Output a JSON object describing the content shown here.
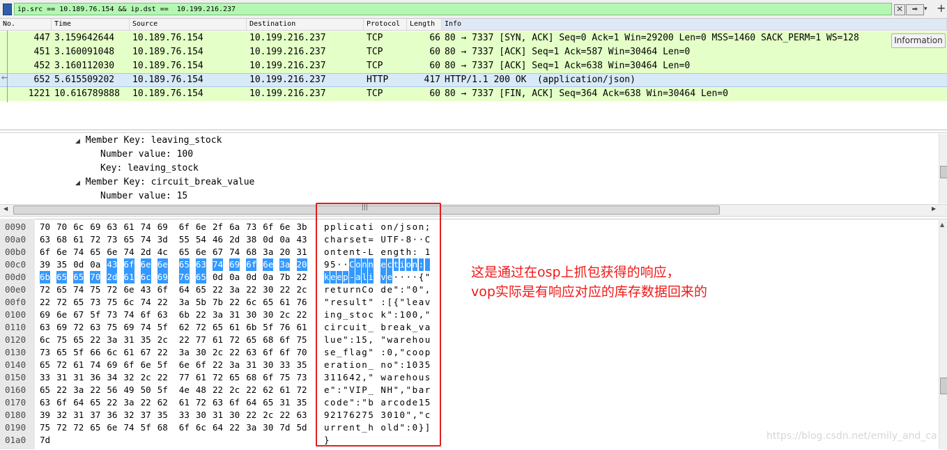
{
  "filter": {
    "text": "ip.src == 10.189.76.154 && ip.dst ==  10.199.216.237",
    "clear_icon": "close-icon",
    "apply_icon": "arrow-right-icon"
  },
  "packet_list": {
    "columns": [
      "No.",
      "Time",
      "Source",
      "Destination",
      "Protocol",
      "Length",
      "Info"
    ],
    "rows": [
      {
        "no": "447",
        "time": "3.159642644",
        "src": "10.189.76.154",
        "dst": "10.199.216.237",
        "proto": "TCP",
        "len": "66",
        "info": "80 → 7337 [SYN, ACK] Seq=0 Ack=1 Win=29200 Len=0 MSS=1460 SACK_PERM=1 WS=128"
      },
      {
        "no": "451",
        "time": "3.160091048",
        "src": "10.189.76.154",
        "dst": "10.199.216.237",
        "proto": "TCP",
        "len": "60",
        "info": "80 → 7337 [ACK] Seq=1 Ack=587 Win=30464 Len=0"
      },
      {
        "no": "452",
        "time": "3.160112030",
        "src": "10.189.76.154",
        "dst": "10.199.216.237",
        "proto": "TCP",
        "len": "60",
        "info": "80 → 7337 [ACK] Seq=1 Ack=638 Win=30464 Len=0"
      },
      {
        "no": "652",
        "time": "5.615509202",
        "src": "10.189.76.154",
        "dst": "10.199.216.237",
        "proto": "HTTP",
        "len": "417",
        "info": "HTTP/1.1 200 OK  (application/json)"
      },
      {
        "no": "1221",
        "time": "10.616789888",
        "src": "10.189.76.154",
        "dst": "10.199.216.237",
        "proto": "TCP",
        "len": "60",
        "info": "80 → 7337 [FIN, ACK] Seq=364 Ack=638 Win=30464 Len=0"
      }
    ],
    "information_button": "Information",
    "row_colors": {
      "tcp": "#e4ffc7",
      "selected": "#d8e9f7"
    }
  },
  "details": {
    "lines": [
      "Member Key: leaving_stock",
      "Number value: 100",
      "Key: leaving_stock",
      "Member Key: circuit_break_value",
      "Number value: 15"
    ]
  },
  "bytes": {
    "highlight_color": "#3399ff",
    "rows": [
      {
        "off": "0090",
        "hex": [
          "70",
          "70",
          "6c",
          "69",
          "63",
          "61",
          "74",
          "69",
          "6f",
          "6e",
          "2f",
          "6a",
          "73",
          "6f",
          "6e",
          "3b"
        ],
        "ascii": "pplicati on/json;"
      },
      {
        "off": "00a0",
        "hex": [
          "63",
          "68",
          "61",
          "72",
          "73",
          "65",
          "74",
          "3d",
          "55",
          "54",
          "46",
          "2d",
          "38",
          "0d",
          "0a",
          "43"
        ],
        "ascii": "charset= UTF-8··C"
      },
      {
        "off": "00b0",
        "hex": [
          "6f",
          "6e",
          "74",
          "65",
          "6e",
          "74",
          "2d",
          "4c",
          "65",
          "6e",
          "67",
          "74",
          "68",
          "3a",
          "20",
          "31"
        ],
        "ascii": "ontent-L ength: 1"
      },
      {
        "off": "00c0",
        "hex": [
          "39",
          "35",
          "0d",
          "0a",
          "43",
          "6f",
          "6e",
          "6e",
          "65",
          "63",
          "74",
          "69",
          "6f",
          "6e",
          "3a",
          "20"
        ],
        "ascii": "95··Conn ection: "
      },
      {
        "off": "00d0",
        "hex": [
          "6b",
          "65",
          "65",
          "70",
          "2d",
          "61",
          "6c",
          "69",
          "76",
          "65",
          "0d",
          "0a",
          "0d",
          "0a",
          "7b",
          "22"
        ],
        "ascii": "keep-ali ve····{\""
      },
      {
        "off": "00e0",
        "hex": [
          "72",
          "65",
          "74",
          "75",
          "72",
          "6e",
          "43",
          "6f",
          "64",
          "65",
          "22",
          "3a",
          "22",
          "30",
          "22",
          "2c"
        ],
        "ascii": "returnCo de\":\"0\","
      },
      {
        "off": "00f0",
        "hex": [
          "22",
          "72",
          "65",
          "73",
          "75",
          "6c",
          "74",
          "22",
          "3a",
          "5b",
          "7b",
          "22",
          "6c",
          "65",
          "61",
          "76"
        ],
        "ascii": "\"result\" :[{\"leav"
      },
      {
        "off": "0100",
        "hex": [
          "69",
          "6e",
          "67",
          "5f",
          "73",
          "74",
          "6f",
          "63",
          "6b",
          "22",
          "3a",
          "31",
          "30",
          "30",
          "2c",
          "22"
        ],
        "ascii": "ing_stoc k\":100,\""
      },
      {
        "off": "0110",
        "hex": [
          "63",
          "69",
          "72",
          "63",
          "75",
          "69",
          "74",
          "5f",
          "62",
          "72",
          "65",
          "61",
          "6b",
          "5f",
          "76",
          "61"
        ],
        "ascii": "circuit_ break_va"
      },
      {
        "off": "0120",
        "hex": [
          "6c",
          "75",
          "65",
          "22",
          "3a",
          "31",
          "35",
          "2c",
          "22",
          "77",
          "61",
          "72",
          "65",
          "68",
          "6f",
          "75"
        ],
        "ascii": "lue\":15, \"warehou"
      },
      {
        "off": "0130",
        "hex": [
          "73",
          "65",
          "5f",
          "66",
          "6c",
          "61",
          "67",
          "22",
          "3a",
          "30",
          "2c",
          "22",
          "63",
          "6f",
          "6f",
          "70"
        ],
        "ascii": "se_flag\" :0,\"coop"
      },
      {
        "off": "0140",
        "hex": [
          "65",
          "72",
          "61",
          "74",
          "69",
          "6f",
          "6e",
          "5f",
          "6e",
          "6f",
          "22",
          "3a",
          "31",
          "30",
          "33",
          "35"
        ],
        "ascii": "eration_ no\":1035"
      },
      {
        "off": "0150",
        "hex": [
          "33",
          "31",
          "31",
          "36",
          "34",
          "32",
          "2c",
          "22",
          "77",
          "61",
          "72",
          "65",
          "68",
          "6f",
          "75",
          "73"
        ],
        "ascii": "311642,\" warehous"
      },
      {
        "off": "0160",
        "hex": [
          "65",
          "22",
          "3a",
          "22",
          "56",
          "49",
          "50",
          "5f",
          "4e",
          "48",
          "22",
          "2c",
          "22",
          "62",
          "61",
          "72"
        ],
        "ascii": "e\":\"VIP_ NH\",\"bar"
      },
      {
        "off": "0170",
        "hex": [
          "63",
          "6f",
          "64",
          "65",
          "22",
          "3a",
          "22",
          "62",
          "61",
          "72",
          "63",
          "6f",
          "64",
          "65",
          "31",
          "35"
        ],
        "ascii": "code\":\"b arcode15"
      },
      {
        "off": "0180",
        "hex": [
          "39",
          "32",
          "31",
          "37",
          "36",
          "32",
          "37",
          "35",
          "33",
          "30",
          "31",
          "30",
          "22",
          "2c",
          "22",
          "63"
        ],
        "ascii": "92176275 3010\",\"c"
      },
      {
        "off": "0190",
        "hex": [
          "75",
          "72",
          "72",
          "65",
          "6e",
          "74",
          "5f",
          "68",
          "6f",
          "6c",
          "64",
          "22",
          "3a",
          "30",
          "7d",
          "5d"
        ],
        "ascii": "urrent_h old\":0}]"
      },
      {
        "off": "01a0",
        "hex": [
          "7d"
        ],
        "ascii": "}"
      }
    ]
  },
  "annotation": {
    "line1": "这是通过在osp上抓包获得的响应，",
    "line2": "vop实际是有响应对应的库存数据回来的",
    "color": "#f01818"
  },
  "watermark": "https://blog.csdn.net/emily_and_ca"
}
